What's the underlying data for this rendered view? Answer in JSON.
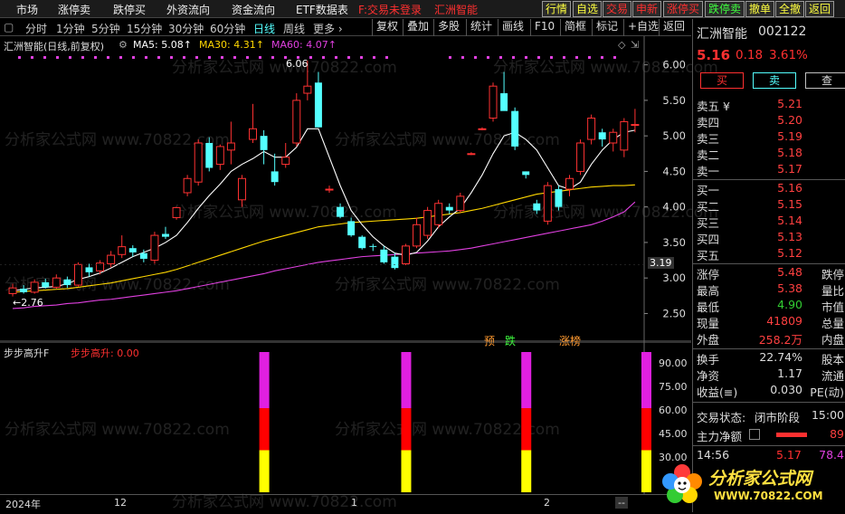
{
  "menubar": {
    "items": [
      "市场",
      "涨停卖",
      "跌停买",
      "外资流向",
      "资金流向",
      "ETF数据表"
    ],
    "login_notice": "F:交易未登录",
    "stock_label": "汇洲智能",
    "tabs": [
      "行情",
      "自选",
      "交易",
      "申新",
      "涨停买",
      "跌停卖",
      "撤单",
      "全撤",
      "返回"
    ]
  },
  "toolbar": {
    "periods": [
      "分时",
      "1分钟",
      "5分钟",
      "15分钟",
      "30分钟",
      "60分钟",
      "日线",
      "周线",
      "更多 ›"
    ],
    "active_period": "日线",
    "buttons": [
      "复权",
      "叠加",
      "多股",
      "统计",
      "画线",
      "F10",
      "简框",
      "标记",
      "+自选",
      "返回"
    ]
  },
  "chart_header": {
    "title": "汇洲智能(日线,前复权)",
    "ma5": "MA5: 5.08↑",
    "ma30": "MA30: 4.31↑",
    "ma60": "MA60: 4.07↑",
    "high_label": "6.06",
    "low_label": "←2.76",
    "current_price_tag": "3.19"
  },
  "indicator": {
    "name": "步步高升F",
    "value_label": "步步高升: 0.00",
    "yticks": [
      "90.00",
      "75.00",
      "60.00",
      "45.00",
      "30.00"
    ]
  },
  "markers": [
    "预",
    "跌",
    "涨榜"
  ],
  "xaxis": {
    "labels": [
      "2024年",
      "12",
      "1",
      "2",
      "--"
    ]
  },
  "colors": {
    "up": "#ff3232",
    "down": "#54ffff",
    "ma5": "#ffffff",
    "ma30": "#ffd700",
    "ma60": "#e040e0"
  },
  "chart_data": {
    "type": "candlestick",
    "title": "汇洲智能(日线,前复权)",
    "ylim": [
      2.2,
      6.25
    ],
    "yticks": [
      2.5,
      3.0,
      3.5,
      4.0,
      4.5,
      5.0,
      5.5,
      6.0
    ],
    "candles": [
      {
        "o": 2.78,
        "h": 2.92,
        "l": 2.74,
        "c": 2.86
      },
      {
        "o": 2.85,
        "h": 2.9,
        "l": 2.78,
        "c": 2.8
      },
      {
        "o": 2.8,
        "h": 2.98,
        "l": 2.78,
        "c": 2.94
      },
      {
        "o": 2.94,
        "h": 2.99,
        "l": 2.85,
        "c": 2.87
      },
      {
        "o": 2.87,
        "h": 3.05,
        "l": 2.85,
        "c": 3.0
      },
      {
        "o": 2.98,
        "h": 3.02,
        "l": 2.86,
        "c": 2.9
      },
      {
        "o": 2.9,
        "h": 3.22,
        "l": 2.88,
        "c": 3.19
      },
      {
        "o": 3.15,
        "h": 3.2,
        "l": 3.02,
        "c": 3.08
      },
      {
        "o": 3.1,
        "h": 3.25,
        "l": 3.05,
        "c": 3.21
      },
      {
        "o": 3.2,
        "h": 3.38,
        "l": 3.15,
        "c": 3.32
      },
      {
        "o": 3.33,
        "h": 3.6,
        "l": 3.28,
        "c": 3.44
      },
      {
        "o": 3.42,
        "h": 3.46,
        "l": 3.3,
        "c": 3.36
      },
      {
        "o": 3.35,
        "h": 3.4,
        "l": 3.22,
        "c": 3.27
      },
      {
        "o": 3.25,
        "h": 3.65,
        "l": 3.2,
        "c": 3.6
      },
      {
        "o": 3.62,
        "h": 3.72,
        "l": 3.55,
        "c": 3.58
      },
      {
        "o": 3.85,
        "h": 4.0,
        "l": 3.82,
        "c": 3.99
      },
      {
        "o": 4.2,
        "h": 4.45,
        "l": 4.15,
        "c": 4.4
      },
      {
        "o": 4.35,
        "h": 4.95,
        "l": 4.3,
        "c": 4.9
      },
      {
        "o": 4.9,
        "h": 4.98,
        "l": 4.5,
        "c": 4.55
      },
      {
        "o": 4.6,
        "h": 4.88,
        "l": 4.52,
        "c": 4.85
      },
      {
        "o": 4.8,
        "h": 5.2,
        "l": 4.6,
        "c": 4.9
      },
      {
        "o": 4.1,
        "h": 4.45,
        "l": 4.0,
        "c": 4.4
      },
      {
        "o": 4.95,
        "h": 5.45,
        "l": 4.9,
        "c": 5.1
      },
      {
        "o": 5.0,
        "h": 5.08,
        "l": 4.6,
        "c": 4.8
      },
      {
        "o": 4.5,
        "h": 4.75,
        "l": 4.3,
        "c": 4.35
      },
      {
        "o": 4.6,
        "h": 4.9,
        "l": 4.55,
        "c": 4.7
      },
      {
        "o": 4.9,
        "h": 5.6,
        "l": 4.85,
        "c": 5.5
      },
      {
        "o": 5.6,
        "h": 6.06,
        "l": 5.5,
        "c": 5.7
      },
      {
        "o": 5.75,
        "h": 5.9,
        "l": 5.12,
        "c": 5.12
      },
      {
        "o": 4.25,
        "h": 4.3,
        "l": 4.2,
        "c": 4.25
      },
      {
        "o": 4.0,
        "h": 4.05,
        "l": 3.84,
        "c": 3.86
      },
      {
        "o": 3.8,
        "h": 3.85,
        "l": 3.58,
        "c": 3.6
      },
      {
        "o": 3.58,
        "h": 3.6,
        "l": 3.4,
        "c": 3.42
      },
      {
        "o": 3.45,
        "h": 3.48,
        "l": 3.38,
        "c": 3.44
      },
      {
        "o": 3.4,
        "h": 3.45,
        "l": 3.2,
        "c": 3.22
      },
      {
        "o": 3.3,
        "h": 3.35,
        "l": 3.12,
        "c": 3.14
      },
      {
        "o": 3.2,
        "h": 3.48,
        "l": 3.18,
        "c": 3.45
      },
      {
        "o": 3.45,
        "h": 3.85,
        "l": 3.42,
        "c": 3.75
      },
      {
        "o": 3.6,
        "h": 4.0,
        "l": 3.55,
        "c": 3.95
      },
      {
        "o": 3.75,
        "h": 4.1,
        "l": 3.7,
        "c": 4.05
      },
      {
        "o": 4.0,
        "h": 4.05,
        "l": 3.9,
        "c": 3.95
      },
      {
        "o": 3.95,
        "h": 4.2,
        "l": 3.92,
        "c": 4.15
      },
      {
        "o": 4.75,
        "h": 4.77,
        "l": 4.73,
        "c": 4.75
      },
      {
        "o": 5.1,
        "h": 5.12,
        "l": 5.08,
        "c": 5.1
      },
      {
        "o": 5.25,
        "h": 5.75,
        "l": 5.2,
        "c": 5.7
      },
      {
        "o": 5.6,
        "h": 5.9,
        "l": 5.5,
        "c": 5.35
      },
      {
        "o": 5.35,
        "h": 5.4,
        "l": 4.8,
        "c": 4.85
      },
      {
        "o": 4.5,
        "h": 4.5,
        "l": 4.4,
        "c": 4.45
      },
      {
        "o": 4.05,
        "h": 4.1,
        "l": 3.9,
        "c": 3.95
      },
      {
        "o": 3.8,
        "h": 4.35,
        "l": 3.75,
        "c": 4.3
      },
      {
        "o": 4.25,
        "h": 4.3,
        "l": 3.95,
        "c": 4.0
      },
      {
        "o": 4.25,
        "h": 4.45,
        "l": 4.15,
        "c": 4.4
      },
      {
        "o": 4.5,
        "h": 4.95,
        "l": 4.45,
        "c": 4.9
      },
      {
        "o": 4.95,
        "h": 5.3,
        "l": 4.88,
        "c": 5.25
      },
      {
        "o": 5.05,
        "h": 5.1,
        "l": 4.85,
        "c": 4.95
      },
      {
        "o": 4.9,
        "h": 5.1,
        "l": 4.78,
        "c": 5.05
      },
      {
        "o": 4.8,
        "h": 5.25,
        "l": 4.7,
        "c": 5.2
      },
      {
        "o": 5.15,
        "h": 5.38,
        "l": 5.05,
        "c": 5.16
      }
    ],
    "ma5": [
      2.82,
      2.84,
      2.86,
      2.87,
      2.88,
      2.92,
      2.98,
      3.02,
      3.07,
      3.14,
      3.22,
      3.3,
      3.36,
      3.42,
      3.5,
      3.6,
      3.78,
      3.98,
      4.16,
      4.32,
      4.5,
      4.6,
      4.68,
      4.78,
      4.7,
      4.7,
      4.84,
      5.1,
      5.1,
      4.7,
      4.3,
      3.95,
      3.75,
      3.58,
      3.45,
      3.35,
      3.32,
      3.36,
      3.52,
      3.72,
      3.86,
      3.98,
      4.2,
      4.45,
      4.75,
      5.0,
      5.05,
      4.95,
      4.8,
      4.55,
      4.3,
      4.25,
      4.35,
      4.6,
      4.8,
      4.95,
      5.05,
      5.08
    ],
    "ma30": [
      2.8,
      2.81,
      2.82,
      2.83,
      2.84,
      2.85,
      2.87,
      2.89,
      2.91,
      2.93,
      2.96,
      2.99,
      3.02,
      3.05,
      3.08,
      3.12,
      3.17,
      3.22,
      3.27,
      3.32,
      3.37,
      3.42,
      3.47,
      3.52,
      3.56,
      3.6,
      3.64,
      3.68,
      3.72,
      3.74,
      3.76,
      3.78,
      3.79,
      3.8,
      3.81,
      3.82,
      3.83,
      3.84,
      3.86,
      3.88,
      3.9,
      3.92,
      3.95,
      3.98,
      4.02,
      4.06,
      4.1,
      4.14,
      4.18,
      4.2,
      4.22,
      4.24,
      4.26,
      4.28,
      4.29,
      4.3,
      4.3,
      4.31
    ],
    "ma60": [
      2.57,
      2.58,
      2.6,
      2.61,
      2.62,
      2.64,
      2.65,
      2.67,
      2.69,
      2.7,
      2.72,
      2.74,
      2.76,
      2.78,
      2.8,
      2.82,
      2.85,
      2.88,
      2.91,
      2.94,
      2.97,
      3.0,
      3.03,
      3.06,
      3.1,
      3.13,
      3.16,
      3.19,
      3.22,
      3.24,
      3.26,
      3.28,
      3.3,
      3.31,
      3.32,
      3.33,
      3.34,
      3.35,
      3.36,
      3.37,
      3.38,
      3.4,
      3.42,
      3.45,
      3.48,
      3.51,
      3.54,
      3.57,
      3.6,
      3.63,
      3.66,
      3.69,
      3.72,
      3.75,
      3.8,
      3.86,
      3.93,
      4.07
    ],
    "signal_bars_index": [
      23,
      36,
      47,
      58
    ]
  },
  "sidepanel": {
    "name": "汇洲智能",
    "code": "002122",
    "price": "5.16",
    "change": "0.18",
    "change_pct": "3.61%",
    "buy_btn": "买",
    "sell_btn": "卖",
    "query_btn": "查",
    "asks": [
      {
        "label": "卖五 ¥",
        "price": "5.21"
      },
      {
        "label": "卖四",
        "price": "5.20"
      },
      {
        "label": "卖三",
        "price": "5.19"
      },
      {
        "label": "卖二",
        "price": "5.18"
      },
      {
        "label": "卖一",
        "price": "5.17"
      }
    ],
    "bids": [
      {
        "label": "买一",
        "price": "5.16"
      },
      {
        "label": "买二",
        "price": "5.15"
      },
      {
        "label": "买三",
        "price": "5.14"
      },
      {
        "label": "买四",
        "price": "5.13"
      },
      {
        "label": "买五",
        "price": "5.12"
      }
    ],
    "stats": [
      {
        "label": "涨停",
        "value": "5.48",
        "right": "跌停",
        "color": "red"
      },
      {
        "label": "最高",
        "value": "5.38",
        "right": "量比",
        "color": "red"
      },
      {
        "label": "最低",
        "value": "4.90",
        "right": "市值",
        "color": "green"
      },
      {
        "label": "现量",
        "value": "41809",
        "right": "总量",
        "color": "red"
      },
      {
        "label": "外盘",
        "value": "258.2万",
        "right": "内盘",
        "color": "red"
      }
    ],
    "stats2": [
      {
        "label": "换手",
        "value": "22.74%",
        "right": "股本"
      },
      {
        "label": "净资",
        "value": "1.17",
        "right": "流通"
      },
      {
        "label": "收益(≡)",
        "value": "0.030",
        "right": "PE(动)"
      }
    ],
    "trade_status_label": "交易状态:",
    "trade_status_value": "闭市阶段",
    "trade_status_time": "15:00",
    "main_flow_label": "主力净额",
    "main_flow_value": "89",
    "tick_time": "14:56",
    "tick_price": "5.17",
    "tick_vol": "78.4"
  },
  "watermark": {
    "text": "分析家公式网 www.70822.com"
  },
  "logo": {
    "brand": "分析家公式网",
    "url": "WWW.70822.COM"
  }
}
